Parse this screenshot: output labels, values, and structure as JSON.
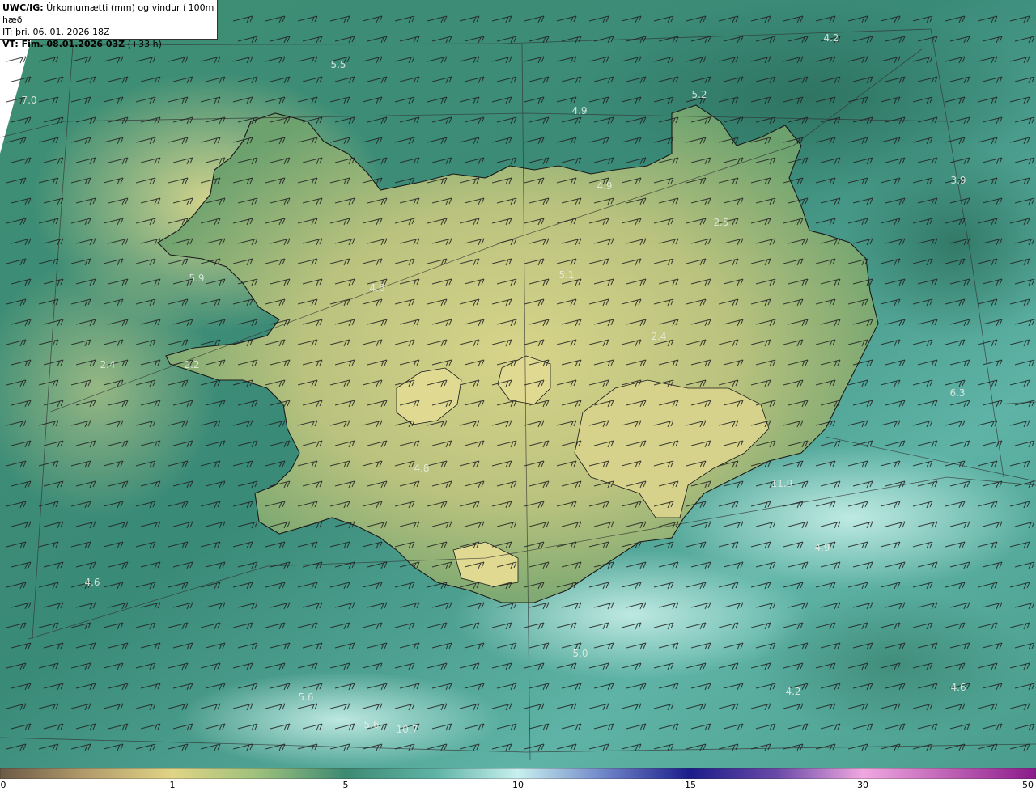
{
  "header": {
    "line1_bold": "UWC/IG:",
    "line1_rest": " Úrkomumætti (mm) og vindur í 100m hæð",
    "line2": "IT: þri. 06. 01. 2026 18Z",
    "line3_bold": "VT: Fim. 08.01.2026 03Z",
    "line3_rest": " (+33 h)"
  },
  "colorbar": {
    "ticks": [
      "0",
      "1",
      "5",
      "10",
      "15",
      "30",
      "50"
    ]
  },
  "map_labels": [
    "5.5",
    "4.2",
    "7.0",
    "4.9",
    "5.2",
    "4.9",
    "3.9",
    "2.5",
    "5.9",
    "4.6",
    "5.1",
    "2.4",
    "2.4",
    "2.2",
    "6.3",
    "4.8",
    "4.9",
    "4.6",
    "5.0",
    "4.2",
    "4.6",
    "5.6",
    "5.6",
    "10.7",
    "11.9"
  ],
  "colors": {
    "sea_dark": "#2e7f72",
    "sea_light": "#a9e2dc",
    "land_low": "#5f9a6a",
    "land_high": "#d9d58a",
    "coast": "#1a1a1a"
  }
}
